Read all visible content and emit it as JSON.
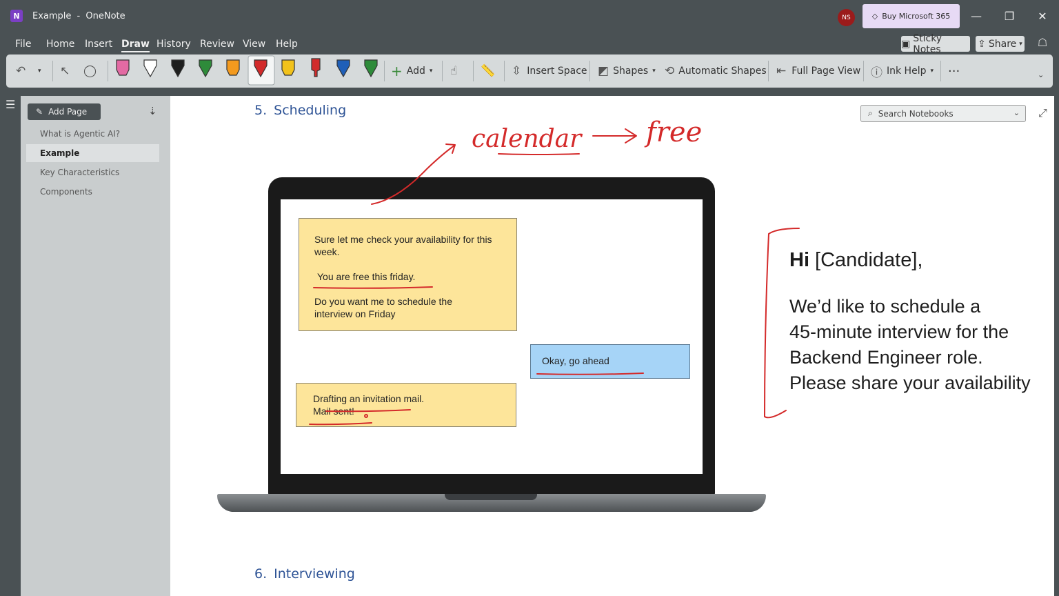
{
  "window": {
    "doc_title": "Example",
    "separator": "-",
    "app_name": "OneNote",
    "avatar_initials": "NS",
    "buy_label": "Buy Microsoft 365"
  },
  "menu": {
    "items": [
      "File",
      "Home",
      "Insert",
      "Draw",
      "History",
      "Review",
      "View",
      "Help"
    ],
    "active": "Draw",
    "sticky_notes": "Sticky Notes",
    "share": "Share"
  },
  "ribbon": {
    "add_label": "Add",
    "insert_space": "Insert Space",
    "shapes": "Shapes",
    "automatic_shapes": "Automatic Shapes",
    "full_page_view": "Full Page View",
    "ink_help": "Ink Help",
    "more": "···",
    "pen_colors": [
      "#e36aa3",
      "#ffffff",
      "#1e1e1e",
      "#2e8b3a",
      "#f39a1e",
      "#d22b2b",
      "#f2c21b",
      "#d22b2b",
      "#1f5fb8",
      "#2e8b3a"
    ]
  },
  "sidebar": {
    "add_page": "Add Page",
    "pages": [
      {
        "label": "What is Agentic AI?",
        "selected": false
      },
      {
        "label": "Example",
        "selected": true
      },
      {
        "label": "Key Characteristics",
        "selected": false
      },
      {
        "label": "Components",
        "selected": false
      }
    ]
  },
  "canvas": {
    "search_placeholder": "Search Notebooks",
    "section5_num": "5.",
    "section5_title": "Scheduling",
    "section6_num": "6.",
    "section6_title": "Interviewing",
    "chat": {
      "bot1_line1": "Sure let me check your availability for this",
      "bot1_line2": "week.",
      "bot1_line3": "You are free this friday.",
      "bot1_line4": "Do you want me to schedule the",
      "bot1_line5": "interview on Friday",
      "user1": "Okay, go ahead",
      "bot2_line1": "Drafting an invitation mail.",
      "bot2_line2": "Mail sent!"
    },
    "email": {
      "greeting_bold": "Hi",
      "greeting_rest": " [Candidate],",
      "line1": "We’d like to schedule a",
      "line2": "45-minute interview for the",
      "line3": "Backend Engineer role.",
      "line4": "Please share your availability"
    },
    "ink_notes": {
      "word1": "calendar",
      "word2": "free",
      "ink_color": "#d42a2a"
    }
  }
}
